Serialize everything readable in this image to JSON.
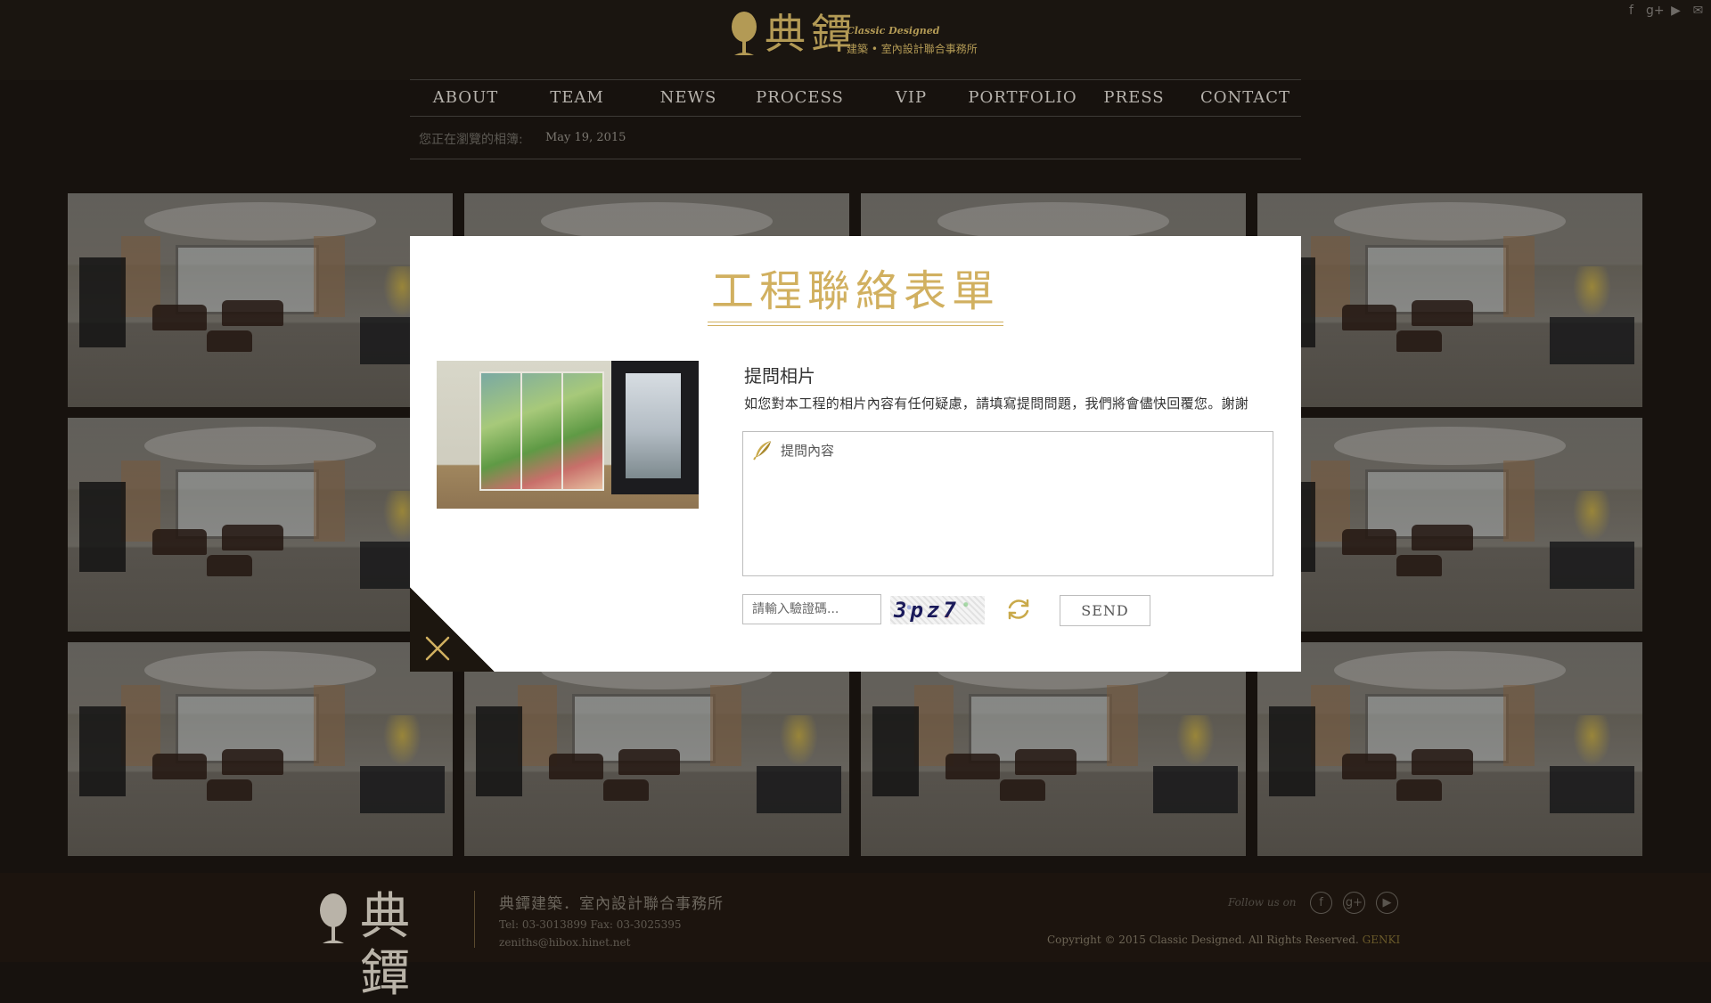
{
  "header": {
    "logo_cn": "典鐔",
    "logo_en": "Classic Designed",
    "logo_sub": "建築 • 室內設計聯合事務所",
    "social": [
      "facebook-icon",
      "google-plus-icon",
      "youtube-icon",
      "mail-icon"
    ]
  },
  "nav": {
    "items": [
      {
        "label": "ABOUT"
      },
      {
        "label": "TEAM"
      },
      {
        "label": "NEWS"
      },
      {
        "label": "PROCESS"
      },
      {
        "label": "VIP"
      },
      {
        "label": "PORTFOLIO"
      },
      {
        "label": "PRESS"
      },
      {
        "label": "CONTACT"
      }
    ]
  },
  "breadcrumb": {
    "label": "您正在瀏覽的相簿:",
    "date": "May 19, 2015"
  },
  "gallery": {
    "count": 12
  },
  "modal": {
    "title": "工程聯絡表單",
    "question_title": "提問相片",
    "description": "如您對本工程的相片內容有任何疑慮，請填寫提問問題，我們將會儘快回覆您。謝謝",
    "question_placeholder": "提問內容",
    "captcha_placeholder": "請輸入驗證碼...",
    "captcha_code": "3pz7",
    "send_label": "SEND"
  },
  "footer": {
    "logo_cn": "典鐔",
    "company": "典鐔建築．室內設計聯合事務所",
    "tel_fax": "Tel: 03-3013899   Fax: 03-3025395",
    "email": "zeniths@hibox.hinet.net",
    "follow": "Follow us on",
    "copyright": "Copyright © 2015 Classic Designed. All Rights Reserved.",
    "credit": "GENKI"
  },
  "colors": {
    "accent_gold": "#d1b060",
    "background": "#17120e",
    "modal_bg": "#ffffff"
  }
}
